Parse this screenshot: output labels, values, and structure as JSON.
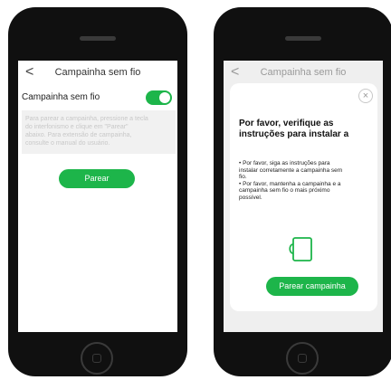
{
  "left_screen": {
    "back_glyph": "<",
    "title": "Campainha sem fio",
    "toggle_label": "Campainha sem fio",
    "toggle_state": "on",
    "help_lines": [
      "Para parear a campainha, pressione a tecla",
      "do interfonismo e clique em \"Parear\"",
      "abaixo. Para extensão de campainha,",
      "consulte o manual do usuário."
    ],
    "pair_button": "Parear"
  },
  "right_screen": {
    "back_glyph": "<",
    "title": "Campainha sem fio",
    "close_glyph": "×",
    "modal_title_lines": [
      "Por favor, verifique as",
      "instruções para instalar a"
    ],
    "instructions": [
      "• Por favor, siga as instruções para",
      "instalar corretamente a campainha sem",
      "fio.",
      "• Por favor, mantenha a campainha e a",
      "campainha sem fio o mais próximo",
      "possível."
    ],
    "icon": "doorbell-chime-icon",
    "pair_button": "Parear campainha"
  },
  "colors": {
    "accent": "#1db54a",
    "phone_body": "#101010",
    "dim_background": "#efefef"
  }
}
